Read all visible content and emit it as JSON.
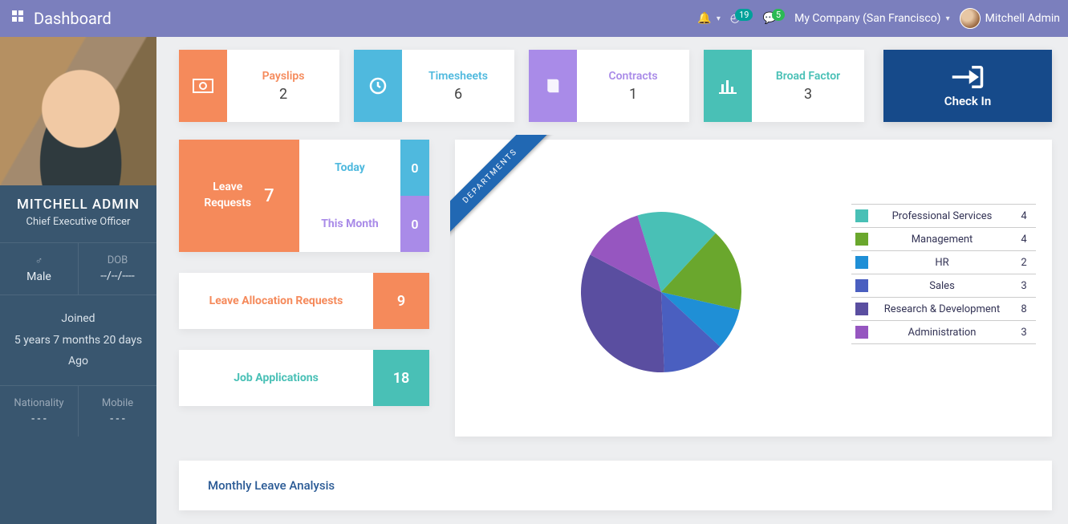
{
  "nav": {
    "title": "Dashboard",
    "badge1": "19",
    "badge2": "5",
    "company": "My Company (San Francisco)",
    "username": "Mitchell Admin"
  },
  "profile": {
    "name": "MITCHELL ADMIN",
    "role": "Chief Executive Officer",
    "gender_label": "♂",
    "gender_value": "Male",
    "dob_label": "DOB",
    "dob_value": "--/--/----",
    "joined_label": "Joined",
    "joined_value": "5 years 7 months 20 days",
    "joined_suffix": "Ago",
    "nat_label": "Nationality",
    "nat_value": "- - -",
    "mob_label": "Mobile",
    "mob_value": "- - -"
  },
  "stats": {
    "payslips_label": "Payslips",
    "payslips_value": "2",
    "timesheets_label": "Timesheets",
    "timesheets_value": "6",
    "contracts_label": "Contracts",
    "contracts_value": "1",
    "broad_label": "Broad Factor",
    "broad_value": "3",
    "checkin_label": "Check In"
  },
  "leave": {
    "title_l1": "Leave",
    "title_l2": "Requests",
    "total": "7",
    "today_label": "Today",
    "today_value": "0",
    "month_label": "This Month",
    "month_value": "0"
  },
  "alloc": {
    "label": "Leave Allocation Requests",
    "value": "9"
  },
  "jobs": {
    "label": "Job Applications",
    "value": "18"
  },
  "departments": {
    "ribbon": "DEPARTMENTS",
    "items": [
      {
        "name": "Professional Services",
        "value": 4,
        "color": "#49c0b6"
      },
      {
        "name": "Management",
        "value": 4,
        "color": "#6aa72d"
      },
      {
        "name": "HR",
        "value": 2,
        "color": "#1f8fd6"
      },
      {
        "name": "Sales",
        "value": 3,
        "color": "#4a5fc0"
      },
      {
        "name": "Research & Development",
        "value": 8,
        "color": "#5a4ea0"
      },
      {
        "name": "Administration",
        "value": 3,
        "color": "#9656c0"
      }
    ]
  },
  "analysis": {
    "title": "Monthly Leave Analysis"
  },
  "chart_data": {
    "type": "pie",
    "title": "Departments",
    "series": [
      {
        "name": "Professional Services",
        "value": 4
      },
      {
        "name": "Management",
        "value": 4
      },
      {
        "name": "HR",
        "value": 2
      },
      {
        "name": "Sales",
        "value": 3
      },
      {
        "name": "Research & Development",
        "value": 8
      },
      {
        "name": "Administration",
        "value": 3
      }
    ]
  }
}
